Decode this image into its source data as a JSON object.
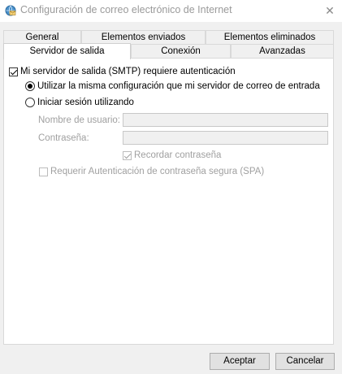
{
  "window": {
    "title": "Configuración de correo electrónico de Internet",
    "icon": "globe-mail-icon",
    "close_symbol": "✕"
  },
  "tabs": {
    "row1": [
      "General",
      "Elementos enviados",
      "Elementos eliminados"
    ],
    "row2": [
      "Servidor de salida",
      "Conexión",
      "Avanzadas"
    ],
    "active": "Servidor de salida"
  },
  "panel": {
    "smtp_auth_label": "Mi servidor de salida (SMTP) requiere autenticación",
    "smtp_auth_checked": true,
    "same_settings_label": "Utilizar la misma configuración que mi servidor de correo de entrada",
    "same_settings_selected": true,
    "login_with_label": "Iniciar sesión utilizando",
    "login_with_selected": false,
    "username_label": "Nombre de usuario:",
    "username_value": "",
    "password_label": "Contraseña:",
    "password_value": "",
    "remember_password_label": "Recordar contraseña",
    "remember_password_checked": true,
    "spa_label": "Requerir Autenticación de contraseña segura (SPA)",
    "spa_checked": false
  },
  "buttons": {
    "accept_label": "Aceptar",
    "cancel_label": "Cancelar"
  }
}
